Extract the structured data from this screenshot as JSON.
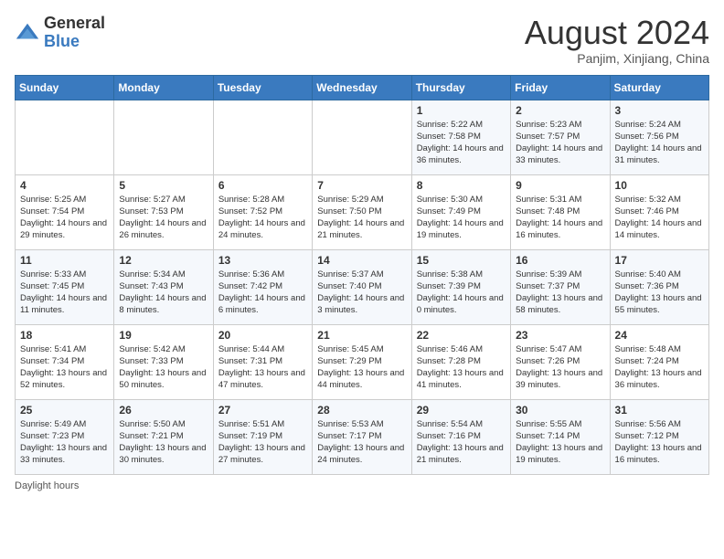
{
  "header": {
    "logo_general": "General",
    "logo_blue": "Blue",
    "month_year": "August 2024",
    "location": "Panjim, Xinjiang, China"
  },
  "days_of_week": [
    "Sunday",
    "Monday",
    "Tuesday",
    "Wednesday",
    "Thursday",
    "Friday",
    "Saturday"
  ],
  "weeks": [
    [
      {
        "day": "",
        "info": ""
      },
      {
        "day": "",
        "info": ""
      },
      {
        "day": "",
        "info": ""
      },
      {
        "day": "",
        "info": ""
      },
      {
        "day": "1",
        "info": "Sunrise: 5:22 AM\nSunset: 7:58 PM\nDaylight: 14 hours and 36 minutes."
      },
      {
        "day": "2",
        "info": "Sunrise: 5:23 AM\nSunset: 7:57 PM\nDaylight: 14 hours and 33 minutes."
      },
      {
        "day": "3",
        "info": "Sunrise: 5:24 AM\nSunset: 7:56 PM\nDaylight: 14 hours and 31 minutes."
      }
    ],
    [
      {
        "day": "4",
        "info": "Sunrise: 5:25 AM\nSunset: 7:54 PM\nDaylight: 14 hours and 29 minutes."
      },
      {
        "day": "5",
        "info": "Sunrise: 5:27 AM\nSunset: 7:53 PM\nDaylight: 14 hours and 26 minutes."
      },
      {
        "day": "6",
        "info": "Sunrise: 5:28 AM\nSunset: 7:52 PM\nDaylight: 14 hours and 24 minutes."
      },
      {
        "day": "7",
        "info": "Sunrise: 5:29 AM\nSunset: 7:50 PM\nDaylight: 14 hours and 21 minutes."
      },
      {
        "day": "8",
        "info": "Sunrise: 5:30 AM\nSunset: 7:49 PM\nDaylight: 14 hours and 19 minutes."
      },
      {
        "day": "9",
        "info": "Sunrise: 5:31 AM\nSunset: 7:48 PM\nDaylight: 14 hours and 16 minutes."
      },
      {
        "day": "10",
        "info": "Sunrise: 5:32 AM\nSunset: 7:46 PM\nDaylight: 14 hours and 14 minutes."
      }
    ],
    [
      {
        "day": "11",
        "info": "Sunrise: 5:33 AM\nSunset: 7:45 PM\nDaylight: 14 hours and 11 minutes."
      },
      {
        "day": "12",
        "info": "Sunrise: 5:34 AM\nSunset: 7:43 PM\nDaylight: 14 hours and 8 minutes."
      },
      {
        "day": "13",
        "info": "Sunrise: 5:36 AM\nSunset: 7:42 PM\nDaylight: 14 hours and 6 minutes."
      },
      {
        "day": "14",
        "info": "Sunrise: 5:37 AM\nSunset: 7:40 PM\nDaylight: 14 hours and 3 minutes."
      },
      {
        "day": "15",
        "info": "Sunrise: 5:38 AM\nSunset: 7:39 PM\nDaylight: 14 hours and 0 minutes."
      },
      {
        "day": "16",
        "info": "Sunrise: 5:39 AM\nSunset: 7:37 PM\nDaylight: 13 hours and 58 minutes."
      },
      {
        "day": "17",
        "info": "Sunrise: 5:40 AM\nSunset: 7:36 PM\nDaylight: 13 hours and 55 minutes."
      }
    ],
    [
      {
        "day": "18",
        "info": "Sunrise: 5:41 AM\nSunset: 7:34 PM\nDaylight: 13 hours and 52 minutes."
      },
      {
        "day": "19",
        "info": "Sunrise: 5:42 AM\nSunset: 7:33 PM\nDaylight: 13 hours and 50 minutes."
      },
      {
        "day": "20",
        "info": "Sunrise: 5:44 AM\nSunset: 7:31 PM\nDaylight: 13 hours and 47 minutes."
      },
      {
        "day": "21",
        "info": "Sunrise: 5:45 AM\nSunset: 7:29 PM\nDaylight: 13 hours and 44 minutes."
      },
      {
        "day": "22",
        "info": "Sunrise: 5:46 AM\nSunset: 7:28 PM\nDaylight: 13 hours and 41 minutes."
      },
      {
        "day": "23",
        "info": "Sunrise: 5:47 AM\nSunset: 7:26 PM\nDaylight: 13 hours and 39 minutes."
      },
      {
        "day": "24",
        "info": "Sunrise: 5:48 AM\nSunset: 7:24 PM\nDaylight: 13 hours and 36 minutes."
      }
    ],
    [
      {
        "day": "25",
        "info": "Sunrise: 5:49 AM\nSunset: 7:23 PM\nDaylight: 13 hours and 33 minutes."
      },
      {
        "day": "26",
        "info": "Sunrise: 5:50 AM\nSunset: 7:21 PM\nDaylight: 13 hours and 30 minutes."
      },
      {
        "day": "27",
        "info": "Sunrise: 5:51 AM\nSunset: 7:19 PM\nDaylight: 13 hours and 27 minutes."
      },
      {
        "day": "28",
        "info": "Sunrise: 5:53 AM\nSunset: 7:17 PM\nDaylight: 13 hours and 24 minutes."
      },
      {
        "day": "29",
        "info": "Sunrise: 5:54 AM\nSunset: 7:16 PM\nDaylight: 13 hours and 21 minutes."
      },
      {
        "day": "30",
        "info": "Sunrise: 5:55 AM\nSunset: 7:14 PM\nDaylight: 13 hours and 19 minutes."
      },
      {
        "day": "31",
        "info": "Sunrise: 5:56 AM\nSunset: 7:12 PM\nDaylight: 13 hours and 16 minutes."
      }
    ]
  ],
  "footer": {
    "daylight_label": "Daylight hours"
  }
}
